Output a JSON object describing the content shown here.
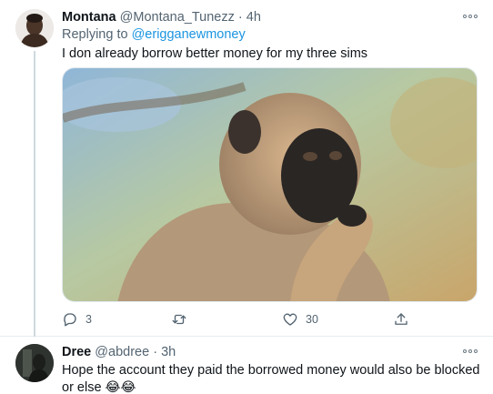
{
  "tweets": [
    {
      "display_name": "Montana",
      "handle": "@Montana_Tunezz",
      "separator": "·",
      "time": "4h",
      "replying_prefix": "Replying to ",
      "replying_to": "@erigganewmoney",
      "text": "I don already borrow better money for my three sims",
      "media": "monkey-thinking-photo",
      "actions": {
        "reply_count": "3",
        "retweet_count": "",
        "like_count": "30"
      }
    },
    {
      "display_name": "Dree",
      "handle": "@abdree",
      "separator": "·",
      "time": "3h",
      "text": "Hope the account they paid the borrowed money would also be blocked or else 😂😂"
    }
  ],
  "icons": {
    "more": "more-horizontal-icon",
    "reply": "reply-icon",
    "retweet": "retweet-icon",
    "like": "heart-icon",
    "share": "share-icon"
  },
  "colors": {
    "link": "#1b95e0",
    "secondary_text": "#536471",
    "divider": "#e6ecf0"
  }
}
